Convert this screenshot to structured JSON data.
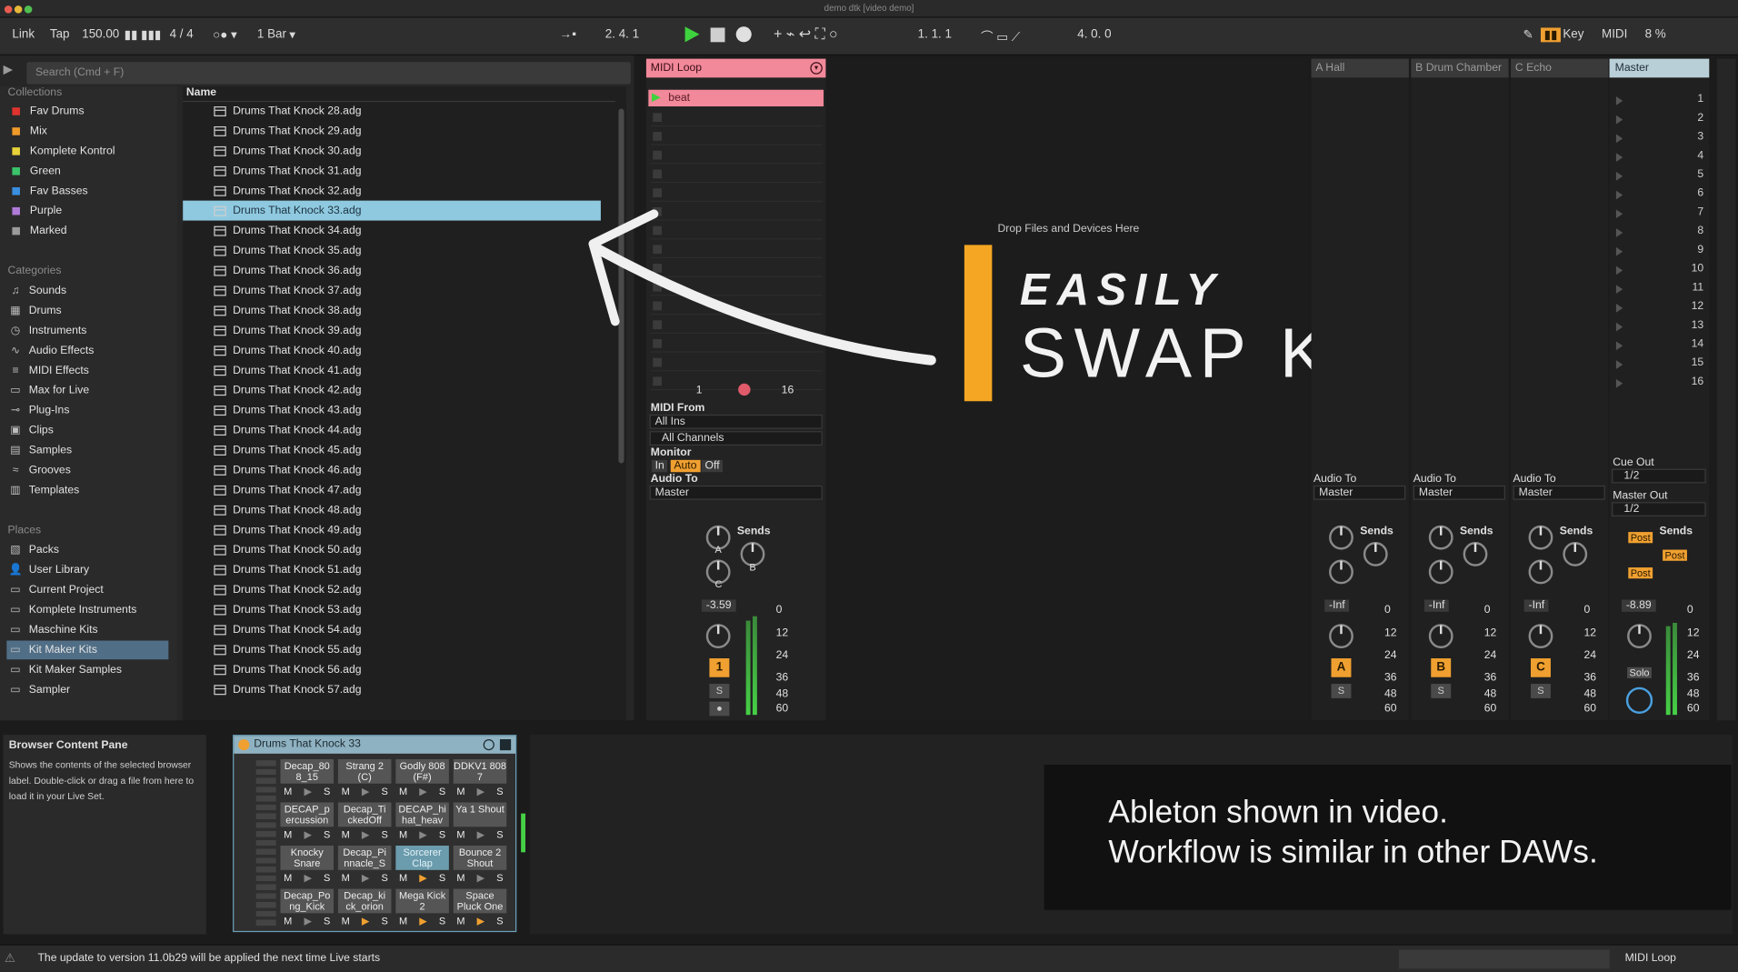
{
  "window": {
    "title": "demo dtk [video demo]"
  },
  "control": {
    "link": "Link",
    "tap": "Tap",
    "tempo": "150.00",
    "signature": "4 / 4",
    "quant": "1 Bar",
    "position": "2.  4.  1",
    "loop_start": "1.  1.  1",
    "loop_len": "4.  0.  0",
    "key": "Key",
    "midi": "MIDI",
    "cpu": "8 %"
  },
  "browser": {
    "search_placeholder": "Search (Cmd + F)",
    "collections_label": "Collections",
    "collections": [
      {
        "label": "Fav Drums",
        "color": "#e0332e"
      },
      {
        "label": "Mix",
        "color": "#f09a2a"
      },
      {
        "label": "Komplete Kontrol",
        "color": "#e8d23a"
      },
      {
        "label": "Green",
        "color": "#3bc46b"
      },
      {
        "label": "Fav Basses",
        "color": "#3a8fe0"
      },
      {
        "label": "Purple",
        "color": "#b07ad8"
      },
      {
        "label": "Marked",
        "color": "#9a9a9a"
      }
    ],
    "categories_label": "Categories",
    "categories": [
      {
        "label": "Sounds",
        "icon": "music-note-icon"
      },
      {
        "label": "Drums",
        "icon": "grid-icon"
      },
      {
        "label": "Instruments",
        "icon": "clock-icon"
      },
      {
        "label": "Audio Effects",
        "icon": "waveform-icon"
      },
      {
        "label": "MIDI Effects",
        "icon": "sliders-icon"
      },
      {
        "label": "Max for Live",
        "icon": "box-icon"
      },
      {
        "label": "Plug-Ins",
        "icon": "plug-icon"
      },
      {
        "label": "Clips",
        "icon": "clip-icon"
      },
      {
        "label": "Samples",
        "icon": "sample-icon"
      },
      {
        "label": "Grooves",
        "icon": "groove-icon"
      },
      {
        "label": "Templates",
        "icon": "template-icon"
      }
    ],
    "places_label": "Places",
    "places": [
      {
        "label": "Packs",
        "icon": "package-icon"
      },
      {
        "label": "User Library",
        "icon": "user-icon"
      },
      {
        "label": "Current Project",
        "icon": "folder-icon"
      },
      {
        "label": "Komplete Instruments",
        "icon": "folder-icon"
      },
      {
        "label": "Maschine Kits",
        "icon": "folder-icon"
      },
      {
        "label": "Kit Maker Kits",
        "icon": "folder-icon",
        "selected": true
      },
      {
        "label": "Kit Maker Samples",
        "icon": "folder-icon"
      },
      {
        "label": "Sampler",
        "icon": "folder-icon"
      }
    ],
    "name_header": "Name",
    "files": [
      "Drums That Knock 28.adg",
      "Drums That Knock 29.adg",
      "Drums That Knock 30.adg",
      "Drums That Knock 31.adg",
      "Drums That Knock 32.adg",
      "Drums That Knock 33.adg",
      "Drums That Knock 34.adg",
      "Drums That Knock 35.adg",
      "Drums That Knock 36.adg",
      "Drums That Knock 37.adg",
      "Drums That Knock 38.adg",
      "Drums That Knock 39.adg",
      "Drums That Knock 40.adg",
      "Drums That Knock 41.adg",
      "Drums That Knock 42.adg",
      "Drums That Knock 43.adg",
      "Drums That Knock 44.adg",
      "Drums That Knock 45.adg",
      "Drums That Knock 46.adg",
      "Drums That Knock 47.adg",
      "Drums That Knock 48.adg",
      "Drums That Knock 49.adg",
      "Drums That Knock 50.adg",
      "Drums That Knock 51.adg",
      "Drums That Knock 52.adg",
      "Drums That Knock 53.adg",
      "Drums That Knock 54.adg",
      "Drums That Knock 55.adg",
      "Drums That Knock 56.adg",
      "Drums That Knock 57.adg"
    ],
    "selected_file": "Drums That Knock 33.adg"
  },
  "track": {
    "name": "MIDI Loop",
    "clip": "beat",
    "range_start": "1",
    "range_end": "16",
    "midi_from_label": "MIDI From",
    "midi_from": "All Ins",
    "channel": "All Channels",
    "monitor_label": "Monitor",
    "monitor_in": "In",
    "monitor_auto": "Auto",
    "monitor_off": "Off",
    "audio_to_label": "Audio To",
    "audio_to": "Master",
    "sends_label": "Sends",
    "send_a": "A",
    "send_b": "B",
    "send_c": "C",
    "volume": "-3.59",
    "track_number": "1",
    "solo": "S",
    "meter_scale": [
      "0",
      "12",
      "24",
      "36",
      "48",
      "60"
    ]
  },
  "session": {
    "drop_text": "Drop Files and Devices Here",
    "headline_small": "EASILY",
    "headline_big": "SWAP KITS"
  },
  "returns": [
    {
      "name": "A Hall",
      "letter": "A",
      "volume": "-Inf"
    },
    {
      "name": "B Drum Chamber",
      "letter": "B",
      "volume": "-Inf"
    },
    {
      "name": "C Echo",
      "letter": "C",
      "volume": "-Inf"
    }
  ],
  "returns_audio_to_label": "Audio To",
  "returns_audio_to": "Master",
  "master": {
    "name": "Master",
    "cue_out_label": "Cue Out",
    "cue_out": "1/2",
    "master_out_label": "Master Out",
    "master_out": "1/2",
    "volume": "-8.89",
    "solo": "Solo",
    "post": "Post",
    "scenes": [
      "1",
      "2",
      "3",
      "4",
      "5",
      "6",
      "7",
      "8",
      "9",
      "10",
      "11",
      "12",
      "13",
      "14",
      "15",
      "16"
    ]
  },
  "info": {
    "title": "Browser Content Pane",
    "text": "Shows the contents of the selected browser label. Double-click or drag a file from here to load it in your Live Set."
  },
  "rack": {
    "name": "Drums That Knock 33",
    "mute": "M",
    "solo": "S",
    "pads": [
      {
        "name": "Decap_80 8_15"
      },
      {
        "name": "Strang 2 (C)"
      },
      {
        "name": "Godly 808 (F#)"
      },
      {
        "name": "DDKV1 808 7"
      },
      {
        "name": "DECAP_p ercussion"
      },
      {
        "name": "Decap_Ti ckedOff"
      },
      {
        "name": "DECAP_hi hat_heav"
      },
      {
        "name": "Ya 1 Shout"
      },
      {
        "name": "Knocky Snare"
      },
      {
        "name": "Decap_Pi nnacle_S"
      },
      {
        "name": "Sorcerer Clap",
        "highlight": true
      },
      {
        "name": "Bounce 2 Shout"
      },
      {
        "name": "Decap_Po ng_Kick"
      },
      {
        "name": "Decap_ki ck_orion"
      },
      {
        "name": "Mega Kick 2"
      },
      {
        "name": "Space Pluck One"
      }
    ]
  },
  "note": {
    "line1": "Ableton shown in video.",
    "line2": "Workflow is similar in other DAWs."
  },
  "status": {
    "message": "The update to version 11.0b29 will be applied the next time Live starts",
    "track": "MIDI Loop"
  }
}
